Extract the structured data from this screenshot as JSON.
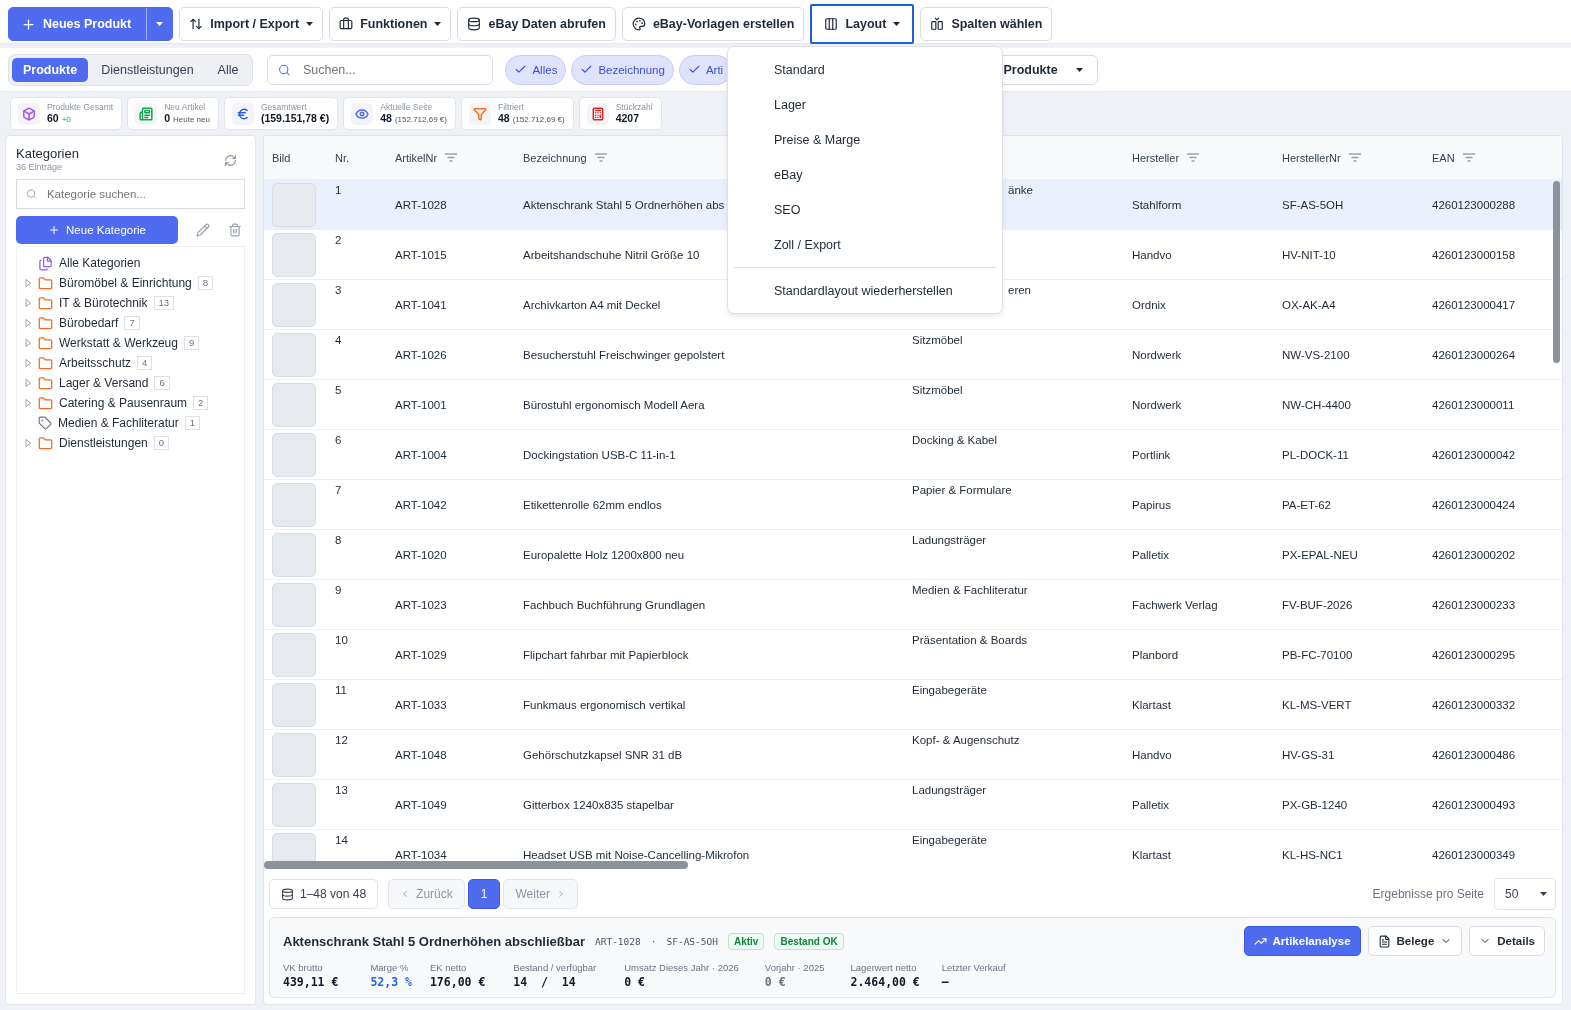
{
  "toolbar": [
    {
      "label": "Neues Produkt",
      "kind": "primary"
    },
    {
      "label": "Import / Export",
      "kind": "menu"
    },
    {
      "label": "Funktionen",
      "kind": "menu"
    },
    {
      "label": "eBay Daten abrufen",
      "kind": "plain"
    },
    {
      "label": "eBay-Vorlagen erstellen",
      "kind": "plain"
    },
    {
      "label": "Layout",
      "kind": "menu",
      "selected": true
    },
    {
      "label": "Spalten wählen",
      "kind": "plain"
    }
  ],
  "segments": [
    {
      "label": "Produkte",
      "selected": true
    },
    {
      "label": "Dienstleistungen",
      "selected": false
    },
    {
      "label": "Alle",
      "selected": false
    }
  ],
  "search": {
    "placeholder": "Suchen..."
  },
  "chips": [
    {
      "label": "Alles",
      "checked": true
    },
    {
      "label": "Bezeichnung",
      "checked": true
    },
    {
      "label": "Arti",
      "checked": true
    }
  ],
  "scope_select": {
    "value": "Produkte"
  },
  "stats": [
    {
      "label": "Produkte Gesamt",
      "value": "60",
      "extra": "+0",
      "color": "#a855f7"
    },
    {
      "label": "Neu Artikel",
      "value": "0",
      "extra": "Heute neu",
      "color": "#16a34a"
    },
    {
      "label": "Gesamtwert",
      "value": "(159.151,78 €)",
      "color": "#2563eb"
    },
    {
      "label": "Aktuelle Seite",
      "value": "48",
      "extra": "(152.712,69 €)",
      "color": "#4f6bed"
    },
    {
      "label": "Filtriert",
      "value": "48",
      "extra": "(152.712,69 €)",
      "color": "#f97316"
    },
    {
      "label": "Stückzahl",
      "value": "4207",
      "color": "#dc2626"
    }
  ],
  "sidebar": {
    "title": "Kategorien",
    "subtitle": "36 Einträge",
    "search_placeholder": "Kategorie suchen...",
    "new_button": "Neue Kategorie",
    "items": [
      {
        "label": "Alle Kategorien",
        "kind": "all"
      },
      {
        "label": "Büromöbel & Einrichtung",
        "count": "8",
        "kind": "folder",
        "expanded": false
      },
      {
        "label": "IT & Bürotechnik",
        "count": "13",
        "kind": "folder",
        "expanded": false
      },
      {
        "label": "Bürobedarf",
        "count": "7",
        "kind": "folder",
        "expanded": false
      },
      {
        "label": "Werkstatt & Werkzeug",
        "count": "9",
        "kind": "folder",
        "expanded": false
      },
      {
        "label": "Arbeitsschutz",
        "count": "4",
        "kind": "folder",
        "expanded": false
      },
      {
        "label": "Lager & Versand",
        "count": "6",
        "kind": "folder",
        "expanded": false
      },
      {
        "label": "Catering & Pausenraum",
        "count": "2",
        "kind": "folder",
        "expanded": false
      },
      {
        "label": "Medien & Fachliteratur",
        "count": "1",
        "kind": "tag"
      },
      {
        "label": "Dienstleistungen",
        "count": "0",
        "kind": "folder",
        "expanded": false
      }
    ]
  },
  "table": {
    "columns": [
      {
        "label": "Bild"
      },
      {
        "label": "Nr."
      },
      {
        "label": "ArtikelNr"
      },
      {
        "label": "Bezeichnung"
      },
      {
        "label": "Hersteller"
      },
      {
        "label": "HerstellerNr"
      },
      {
        "label": "EAN"
      }
    ],
    "rows": [
      {
        "nr": "1",
        "artikelnr": "ART-1028",
        "bezeichnung": "Aktenschrank Stahl 5 Ordnerhöhen abs",
        "category": "änke",
        "hersteller": "Stahlform",
        "herstellernr": "SF-AS-5OH",
        "ean": "4260123000288",
        "selected": true
      },
      {
        "nr": "2",
        "artikelnr": "ART-1015",
        "bezeichnung": "Arbeitshandschuhe Nitril Größe 10",
        "hersteller": "Handvo",
        "herstellernr": "HV-NIT-10",
        "ean": "4260123000158",
        "selected": false
      },
      {
        "nr": "3",
        "artikelnr": "ART-1041",
        "bezeichnung": "Archivkarton A4 mit Deckel",
        "category": "eren",
        "hersteller": "Ordnix",
        "herstellernr": "OX-AK-A4",
        "ean": "4260123000417",
        "selected": false
      },
      {
        "nr": "4",
        "artikelnr": "ART-1026",
        "bezeichnung": "Besucherstuhl Freischwinger gepolstert",
        "category": "Sitzmöbel",
        "hersteller": "Nordwerk",
        "herstellernr": "NW-VS-2100",
        "ean": "4260123000264",
        "selected": false
      },
      {
        "nr": "5",
        "artikelnr": "ART-1001",
        "bezeichnung": "Bürostuhl ergonomisch Modell Aera",
        "category": "Sitzmöbel",
        "hersteller": "Nordwerk",
        "herstellernr": "NW-CH-4400",
        "ean": "4260123000011",
        "selected": false
      },
      {
        "nr": "6",
        "artikelnr": "ART-1004",
        "bezeichnung": "Dockingstation USB-C 11-in-1",
        "category": "Docking & Kabel",
        "hersteller": "Portlink",
        "herstellernr": "PL-DOCK-11",
        "ean": "4260123000042",
        "selected": false
      },
      {
        "nr": "7",
        "artikelnr": "ART-1042",
        "bezeichnung": "Etikettenrolle 62mm endlos",
        "category": "Papier & Formulare",
        "hersteller": "Papirus",
        "herstellernr": "PA-ET-62",
        "ean": "4260123000424",
        "selected": false
      },
      {
        "nr": "8",
        "artikelnr": "ART-1020",
        "bezeichnung": "Europalette Holz 1200x800 neu",
        "category": "Ladungsträger",
        "hersteller": "Palletix",
        "herstellernr": "PX-EPAL-NEU",
        "ean": "4260123000202",
        "selected": false
      },
      {
        "nr": "9",
        "artikelnr": "ART-1023",
        "bezeichnung": "Fachbuch Buchführung Grundlagen",
        "category": "Medien & Fachliteratur",
        "hersteller": "Fachwerk Verlag",
        "herstellernr": "FV-BUF-2026",
        "ean": "4260123000233",
        "selected": false
      },
      {
        "nr": "10",
        "artikelnr": "ART-1029",
        "bezeichnung": "Flipchart fahrbar mit Papierblock",
        "category": "Präsentation & Boards",
        "hersteller": "Planbord",
        "herstellernr": "PB-FC-70100",
        "ean": "4260123000295",
        "selected": false
      },
      {
        "nr": "11",
        "artikelnr": "ART-1033",
        "bezeichnung": "Funkmaus ergonomisch vertikal",
        "category": "Eingabegeräte",
        "hersteller": "Klartast",
        "herstellernr": "KL-MS-VERT",
        "ean": "4260123000332",
        "selected": false
      },
      {
        "nr": "12",
        "artikelnr": "ART-1048",
        "bezeichnung": "Gehörschutzkapsel SNR 31 dB",
        "category": "Kopf- & Augenschutz",
        "hersteller": "Handvo",
        "herstellernr": "HV-GS-31",
        "ean": "4260123000486",
        "selected": false
      },
      {
        "nr": "13",
        "artikelnr": "ART-1049",
        "bezeichnung": "Gitterbox 1240x835 stapelbar",
        "category": "Ladungsträger",
        "hersteller": "Palletix",
        "herstellernr": "PX-GB-1240",
        "ean": "4260123000493",
        "selected": false
      },
      {
        "nr": "14",
        "artikelnr": "ART-1034",
        "bezeichnung": "Headset USB mit Noise-Cancelling-Mikrofon",
        "category": "Eingabegeräte",
        "hersteller": "Klartast",
        "herstellernr": "KL-HS-NC1",
        "ean": "4260123000349",
        "selected": false
      }
    ]
  },
  "pagination": {
    "range": "1–48 von 48",
    "prev": {
      "label": "Zurück",
      "disabled": true
    },
    "pages": [
      {
        "label": "1",
        "selected": true
      }
    ],
    "next": {
      "label": "Weiter",
      "disabled": true
    },
    "per_page_label": "Ergebnisse pro Seite",
    "per_page": "50"
  },
  "detail": {
    "title": "Aktenschrank Stahl 5 Ordnerhöhen abschließbar",
    "artikelnr": "ART-1028",
    "separator": "·",
    "herstellernr": "SF-AS-5OH",
    "badges": [
      "Aktiv",
      "Bestand OK"
    ],
    "buttons": [
      {
        "label": "Artikelanalyse",
        "kind": "primary"
      },
      {
        "label": "Belege",
        "kind": "menu"
      },
      {
        "label": "Details",
        "kind": "toggle"
      }
    ],
    "metrics": [
      {
        "label": "VK brutto",
        "value": "439,11 €",
        "color": "#111827"
      },
      {
        "label": "Marge %",
        "value": "52,3 %",
        "color": "#2563eb"
      },
      {
        "label": "EK netto",
        "value": "176,00 €",
        "color": "#111827"
      },
      {
        "label": "Bestand / verfügbar",
        "value": "14  /  14",
        "color": "#111827"
      },
      {
        "label": "Umsatz Dieses Jahr · 2026",
        "value": "0 €",
        "color": "#111827"
      },
      {
        "label": "Vorjahr · 2025",
        "value": "0 €",
        "color": "#6b7280"
      },
      {
        "label": "Lagerwert netto",
        "value": "2.464,00 €",
        "color": "#111827"
      },
      {
        "label": "Letzter Verkauf",
        "value": "—",
        "color": "#111827"
      }
    ]
  },
  "layout_menu": {
    "open": true,
    "items": [
      "Standard",
      "Lager",
      "Preise & Marge",
      "eBay",
      "SEO",
      "Zoll / Export"
    ],
    "reset": "Standardlayout wiederherstellen"
  }
}
